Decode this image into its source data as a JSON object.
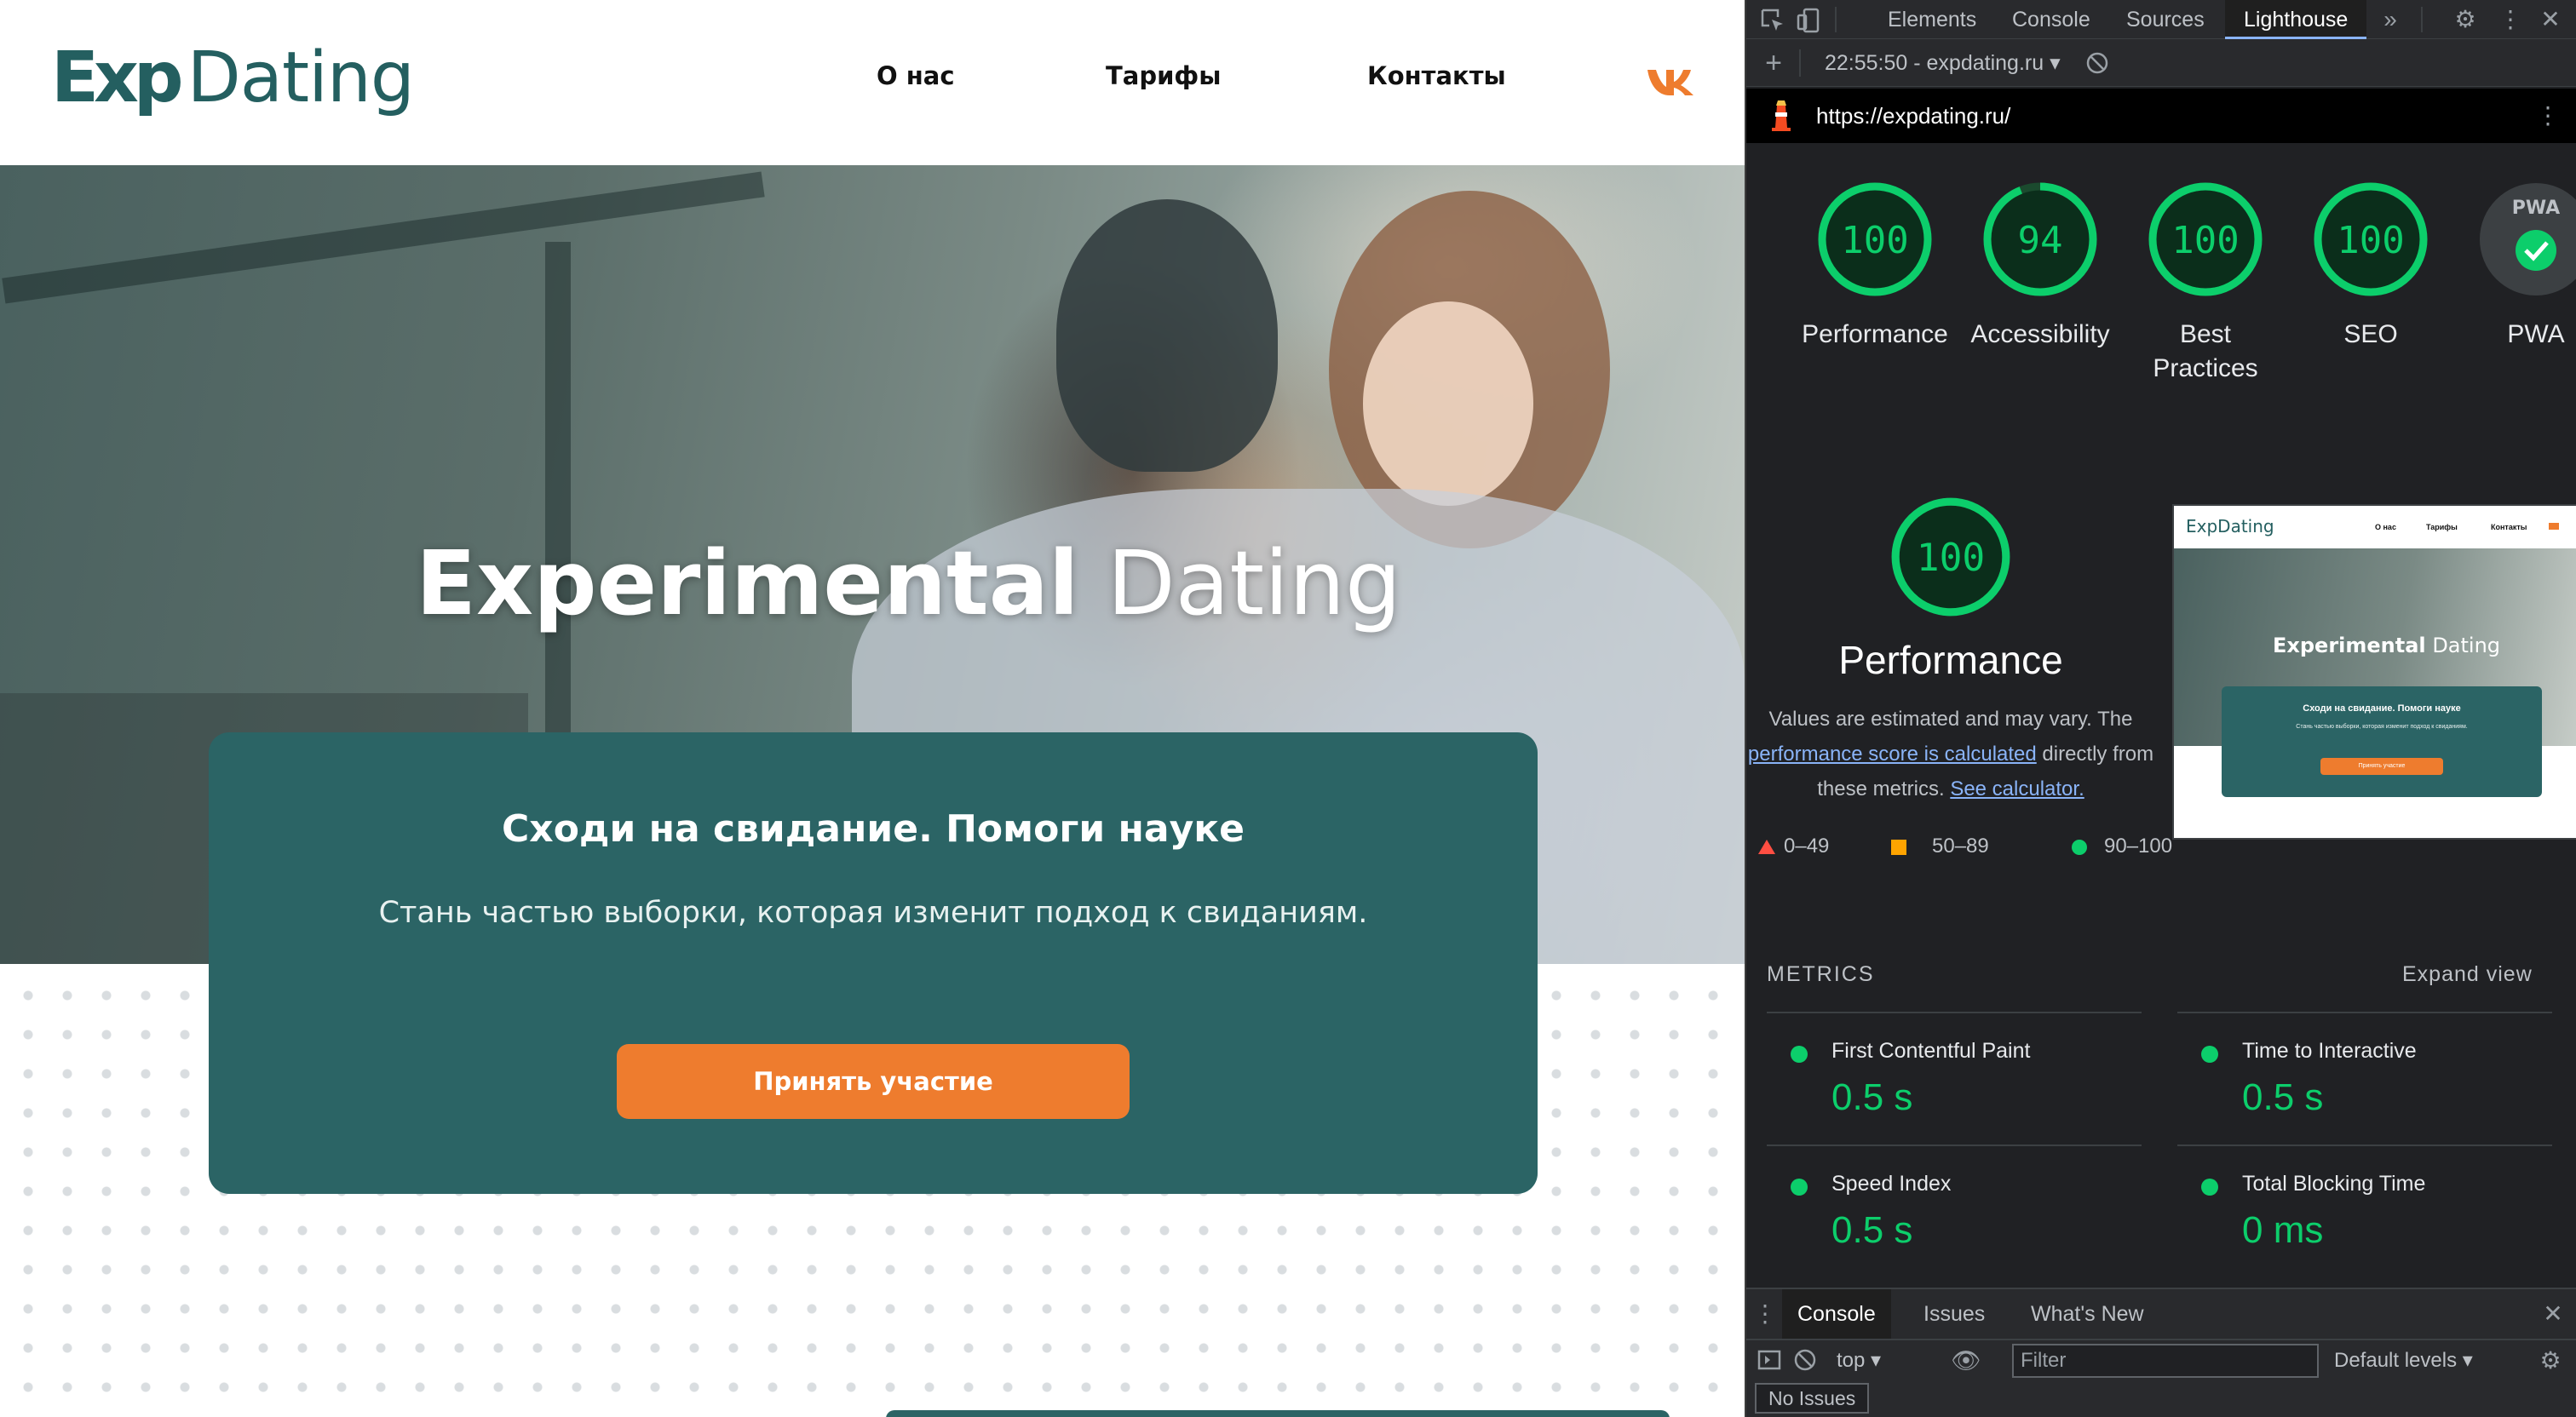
{
  "site": {
    "logo": {
      "bold": "Exp",
      "light": "Dating"
    },
    "nav": [
      "О нас",
      "Тарифы",
      "Контакты"
    ],
    "social_icon": "vk-icon",
    "hero": {
      "title_bold": "Experimental",
      "title_light": "Dating"
    },
    "card": {
      "title": "Сходи на свидание. Помоги науке",
      "subtitle": "Стань частью выборки, которая изменит подход к свиданиям.",
      "cta": "Принять участие"
    },
    "colors": {
      "brand": "#245f60",
      "card": "#2b6465",
      "accent": "#ee7c2e"
    }
  },
  "devtools": {
    "tabs": [
      "Elements",
      "Console",
      "Sources",
      "Lighthouse"
    ],
    "active_tab": "Lighthouse",
    "report_time": "22:55:50 - expdating.ru",
    "url": "https://expdating.ru/",
    "scores": [
      {
        "label": "Performance",
        "value": "100",
        "fraction": 1.0
      },
      {
        "label": "Accessibility",
        "value": "94",
        "fraction": 0.94
      },
      {
        "label": "Best Practices",
        "value": "100",
        "fraction": 1.0
      },
      {
        "label": "SEO",
        "value": "100",
        "fraction": 1.0
      },
      {
        "label": "PWA",
        "value": "PWA"
      }
    ],
    "performance": {
      "score": "100",
      "title": "Performance",
      "desc_1": "Values are estimated and may vary. The",
      "desc_link_1": "performance score is calculated",
      "desc_2": "directly from",
      "desc_3": "these metrics.",
      "desc_link_2": "See calculator."
    },
    "legend": [
      "0–49",
      "50–89",
      "90–100"
    ],
    "thumbnail": {
      "logo": "ExpDating",
      "nav": [
        "О нас",
        "Тарифы",
        "Контакты"
      ],
      "title_bold": "Experimental",
      "title_light": "Dating",
      "card_title": "Сходи на свидание. Помоги науке",
      "card_sub": "Стань частью выборки, которая изменит подход к свиданиям.",
      "cta": "Принять участие"
    },
    "metrics_header": "METRICS",
    "expand_view": "Expand view",
    "metrics": [
      {
        "name": "First Contentful Paint",
        "value": "0.5 s"
      },
      {
        "name": "Time to Interactive",
        "value": "0.5 s"
      },
      {
        "name": "Speed Index",
        "value": "0.5 s"
      },
      {
        "name": "Total Blocking Time",
        "value": "0 ms"
      }
    ],
    "drawer": {
      "tabs": [
        "Console",
        "Issues",
        "What's New"
      ],
      "context": "top",
      "filter_placeholder": "Filter",
      "levels": "Default levels",
      "issues": "No Issues"
    },
    "colors": {
      "pass": "#0cce6b",
      "average": "#ffa400",
      "fail": "#ff4e42",
      "link": "#8ab4f8"
    }
  }
}
